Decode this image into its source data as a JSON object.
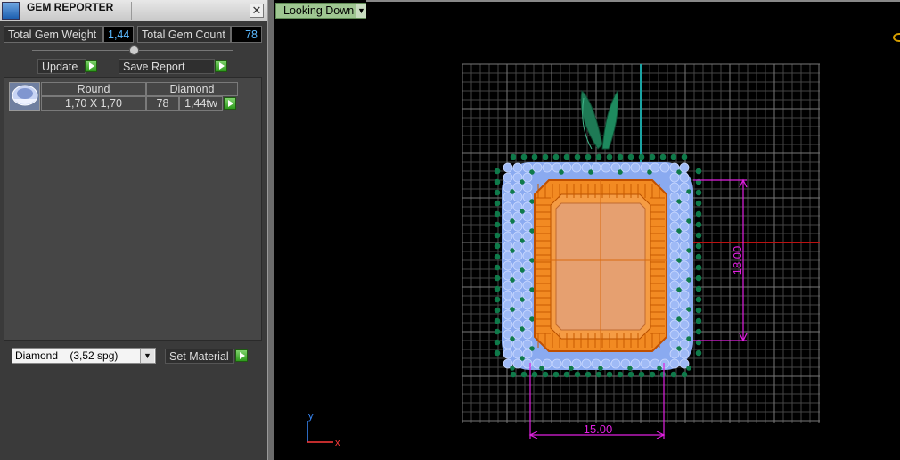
{
  "window": {
    "title": "GEM REPORTER",
    "close_glyph": "✕"
  },
  "summary": {
    "weight_label": "Total Gem Weight",
    "weight_value": "1,44",
    "count_label": "Total Gem Count",
    "count_value": "78"
  },
  "actions": {
    "update": "Update",
    "save_report": "Save Report"
  },
  "gem_table": {
    "headers": [
      "Round",
      "Diamond"
    ],
    "rows": [
      {
        "size": "1,70 X 1,70",
        "count": "78",
        "weight": "1,44tw"
      }
    ]
  },
  "material": {
    "selected": "Diamond    (3,52 spg)",
    "set_label": "Set Material"
  },
  "viewport": {
    "view_label": "Looking Down",
    "dims": {
      "height": "18.00",
      "width": "15.00"
    },
    "axes": {
      "y": "y",
      "x": "x"
    }
  },
  "icons": [
    "gem-reporter-app-icon",
    "close-icon",
    "play-arrow-icon",
    "dropdown-arrow-icon",
    "gem-thumbnail-icon"
  ]
}
